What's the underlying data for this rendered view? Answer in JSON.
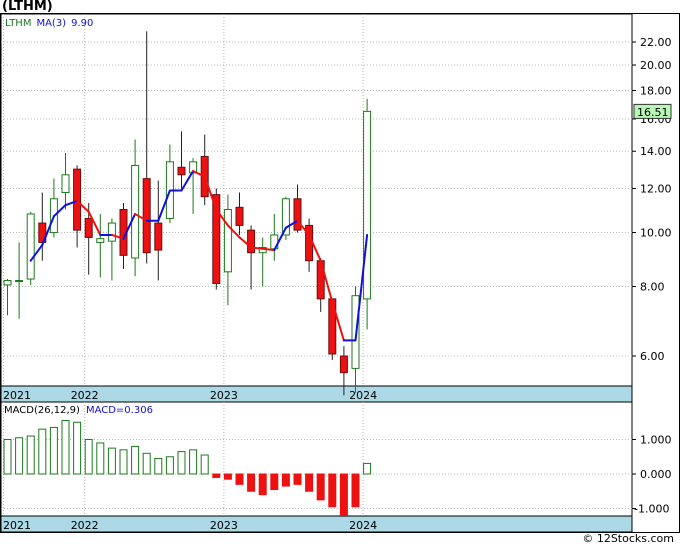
{
  "title": "(LTHM)",
  "watermark": "© 12Stocks.com",
  "price_panel": {
    "legend_symbol": "LTHM",
    "legend_ma": "MA(3)",
    "legend_ma_value": "9.90",
    "last_price_label": "16.51",
    "y_ticks": [
      "6.00",
      "8.00",
      "10.00",
      "12.00",
      "14.00",
      "16.00",
      "18.00",
      "20.00",
      "22.00"
    ],
    "x_ticks": [
      "2021",
      "2022",
      "2023",
      "2024"
    ]
  },
  "macd_panel": {
    "legend_name": "MACD(26,12,9)",
    "legend_value": "MACD=0.306",
    "y_ticks": [
      "1.000",
      "0.000",
      "-1.000"
    ],
    "x_ticks": [
      "2021",
      "2022",
      "2023",
      "2024"
    ]
  },
  "colors": {
    "up_candle_stroke": "#1c7a1c",
    "down_candle_fill": "#ee1111",
    "ma_rising": "#1010dd",
    "ma_falling": "#ee1111",
    "axis_band": "#add8e6",
    "grid": "#b5b5b5",
    "last_price_box": "#b9f7b9"
  },
  "chart_data": [
    {
      "type": "candlestick",
      "interval": "monthly",
      "scale": "log",
      "ylim": [
        5.0,
        24.0
      ],
      "grid": true,
      "legend": "top-left",
      "candles": [
        {
          "open": 8.05,
          "high": 8.25,
          "low": 7.1,
          "close": 8.2
        },
        {
          "open": 8.2,
          "high": 9.6,
          "low": 7.0,
          "close": 8.2
        },
        {
          "open": 8.25,
          "high": 10.9,
          "low": 8.05,
          "close": 10.8
        },
        {
          "open": 10.4,
          "high": 11.8,
          "low": 8.9,
          "close": 9.6
        },
        {
          "open": 10.0,
          "high": 12.5,
          "low": 9.8,
          "close": 11.5
        },
        {
          "open": 11.8,
          "high": 13.9,
          "low": 11.0,
          "close": 12.7
        },
        {
          "open": 13.0,
          "high": 13.2,
          "low": 9.4,
          "close": 10.1
        },
        {
          "open": 10.6,
          "high": 11.3,
          "low": 8.4,
          "close": 9.8
        },
        {
          "open": 9.6,
          "high": 10.8,
          "low": 8.3,
          "close": 9.75
        },
        {
          "open": 9.65,
          "high": 10.6,
          "low": 8.2,
          "close": 10.4
        },
        {
          "open": 11.0,
          "high": 11.3,
          "low": 8.6,
          "close": 9.1
        },
        {
          "open": 9.0,
          "high": 14.7,
          "low": 8.35,
          "close": 13.2
        },
        {
          "open": 12.5,
          "high": 23.0,
          "low": 8.8,
          "close": 9.2
        },
        {
          "open": 10.4,
          "high": 12.4,
          "low": 8.2,
          "close": 9.3
        },
        {
          "open": 10.6,
          "high": 14.4,
          "low": 10.4,
          "close": 13.4
        },
        {
          "open": 13.1,
          "high": 15.2,
          "low": 12.0,
          "close": 12.7
        },
        {
          "open": 12.8,
          "high": 13.6,
          "low": 10.8,
          "close": 13.4
        },
        {
          "open": 13.7,
          "high": 15.0,
          "low": 11.2,
          "close": 11.6
        },
        {
          "open": 11.7,
          "high": 12.0,
          "low": 7.9,
          "close": 8.1
        },
        {
          "open": 8.5,
          "high": 11.7,
          "low": 7.4,
          "close": 11.0
        },
        {
          "open": 11.1,
          "high": 11.8,
          "low": 9.9,
          "close": 10.3
        },
        {
          "open": 10.1,
          "high": 10.3,
          "low": 7.9,
          "close": 9.2
        },
        {
          "open": 9.2,
          "high": 9.8,
          "low": 8.0,
          "close": 9.4
        },
        {
          "open": 9.35,
          "high": 10.8,
          "low": 8.9,
          "close": 9.9
        },
        {
          "open": 9.9,
          "high": 11.6,
          "low": 9.7,
          "close": 11.5
        },
        {
          "open": 11.5,
          "high": 12.2,
          "low": 10.0,
          "close": 10.1
        },
        {
          "open": 10.3,
          "high": 10.6,
          "low": 8.5,
          "close": 8.9
        },
        {
          "open": 8.9,
          "high": 9.0,
          "low": 7.2,
          "close": 7.6
        },
        {
          "open": 7.6,
          "high": 7.6,
          "low": 5.9,
          "close": 6.05
        },
        {
          "open": 6.0,
          "high": 6.25,
          "low": 5.1,
          "close": 5.6
        },
        {
          "open": 5.7,
          "high": 8.0,
          "low": 5.15,
          "close": 7.7
        },
        {
          "open": 7.6,
          "high": 17.4,
          "low": 6.7,
          "close": 16.51
        }
      ],
      "ma3": [
        null,
        null,
        8.9,
        9.5,
        10.7,
        11.2,
        11.4,
        10.9,
        9.9,
        9.9,
        9.75,
        10.8,
        10.5,
        10.5,
        11.9,
        11.9,
        12.9,
        12.6,
        11.0,
        10.3,
        9.8,
        9.4,
        9.35,
        9.3,
        10.2,
        10.5,
        9.9,
        8.9,
        7.5,
        6.4,
        6.4,
        9.9
      ]
    },
    {
      "type": "bar",
      "name": "MACD(26,12,9)",
      "ylim": [
        -1.25,
        2.0
      ],
      "values": [
        1.0,
        1.05,
        1.1,
        1.3,
        1.35,
        1.55,
        1.5,
        1.0,
        0.9,
        0.75,
        0.7,
        0.8,
        0.6,
        0.45,
        0.5,
        0.65,
        0.7,
        0.55,
        -0.1,
        -0.15,
        -0.3,
        -0.5,
        -0.6,
        -0.45,
        -0.35,
        -0.3,
        -0.5,
        -0.75,
        -0.95,
        -1.2,
        -0.95,
        0.306
      ]
    }
  ]
}
